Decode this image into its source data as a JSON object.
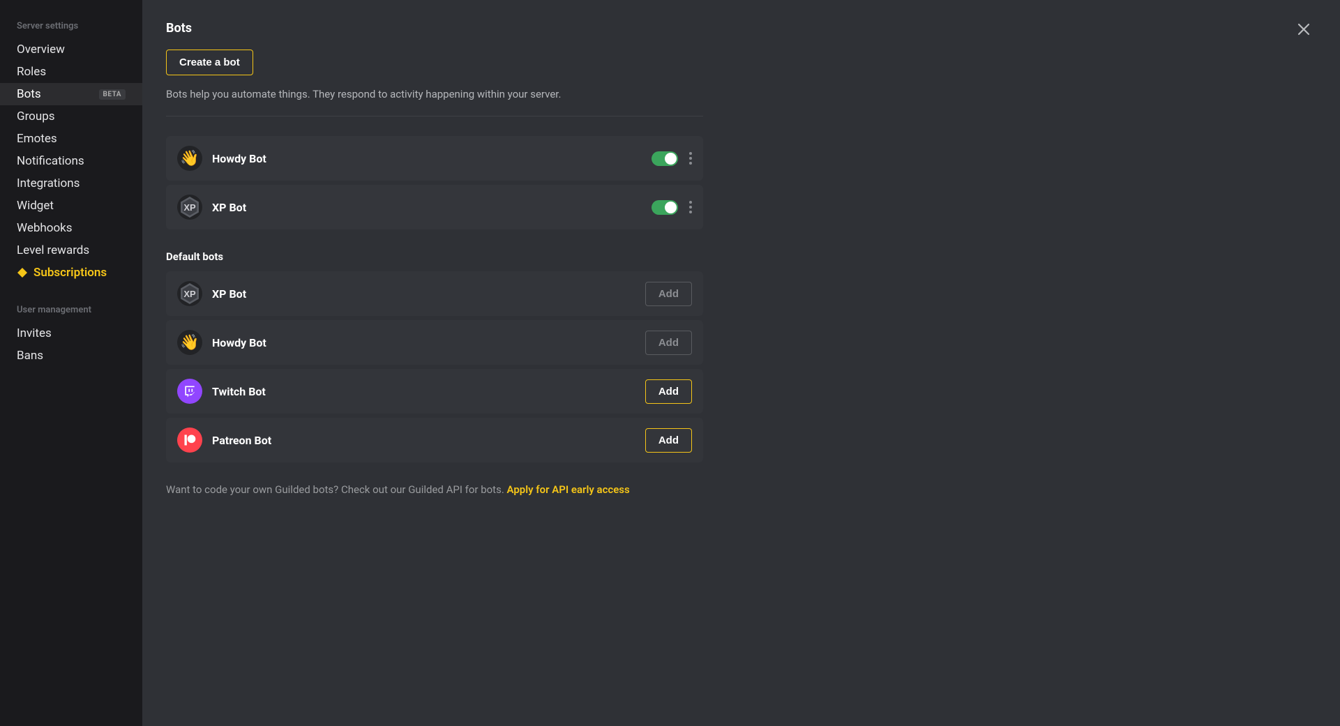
{
  "sidebar": {
    "section1": "Server settings",
    "items1": [
      {
        "label": "Overview"
      },
      {
        "label": "Roles"
      },
      {
        "label": "Bots",
        "active": true,
        "badge": "BETA"
      },
      {
        "label": "Groups"
      },
      {
        "label": "Emotes"
      },
      {
        "label": "Notifications"
      },
      {
        "label": "Integrations"
      },
      {
        "label": "Widget"
      },
      {
        "label": "Webhooks"
      },
      {
        "label": "Level rewards"
      },
      {
        "label": "Subscriptions",
        "highlight": true
      }
    ],
    "section2": "User management",
    "items2": [
      {
        "label": "Invites"
      },
      {
        "label": "Bans"
      }
    ]
  },
  "page": {
    "title": "Bots",
    "create_label": "Create a bot",
    "description": "Bots help you automate things. They respond to activity happening within your server.",
    "default_title": "Default bots",
    "footer_text": "Want to code your own Guilded bots? Check out our Guilded API for bots. ",
    "footer_link": "Apply for API early access"
  },
  "active_bots": [
    {
      "name": "Howdy Bot",
      "icon": "wave",
      "enabled": true
    },
    {
      "name": "XP Bot",
      "icon": "xp",
      "enabled": true
    }
  ],
  "default_bots": [
    {
      "name": "XP Bot",
      "icon": "xp",
      "add_label": "Add",
      "added": true
    },
    {
      "name": "Howdy Bot",
      "icon": "wave",
      "add_label": "Add",
      "added": true
    },
    {
      "name": "Twitch Bot",
      "icon": "twitch",
      "add_label": "Add",
      "added": false
    },
    {
      "name": "Patreon Bot",
      "icon": "patreon",
      "add_label": "Add",
      "added": false
    }
  ]
}
